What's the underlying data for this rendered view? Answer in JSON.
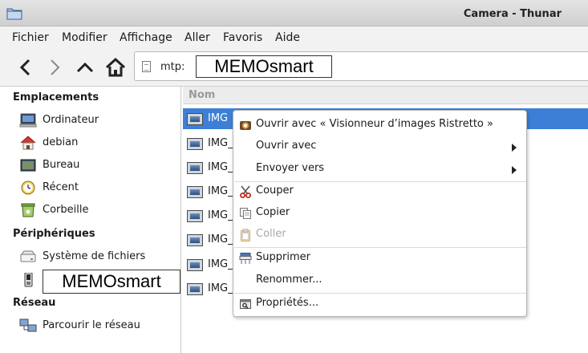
{
  "window": {
    "title": "Camera - Thunar"
  },
  "menubar": {
    "items": [
      "Fichier",
      "Modifier",
      "Affichage",
      "Aller",
      "Favoris",
      "Aide"
    ]
  },
  "toolbar": {
    "back_icon": "chevron-left-icon",
    "forward_icon": "chevron-right-icon",
    "up_icon": "chevron-up-icon",
    "home_icon": "home-icon",
    "location_scheme": "mtp:",
    "location_device": "MEMOsmart"
  },
  "sidebar": {
    "sections": [
      {
        "title": "Emplacements"
      },
      {
        "title": "Périphériques"
      },
      {
        "title": "Réseau"
      }
    ],
    "places": [
      {
        "label": "Ordinateur",
        "icon": "computer-icon"
      },
      {
        "label": "debian",
        "icon": "home-icon"
      },
      {
        "label": "Bureau",
        "icon": "desktop-icon"
      },
      {
        "label": "Récent",
        "icon": "clock-icon"
      },
      {
        "label": "Corbeille",
        "icon": "trash-icon"
      }
    ],
    "devices": [
      {
        "label": "Système de fichiers",
        "icon": "drive-icon"
      },
      {
        "label": "MEMOsmart",
        "icon": "phone-icon"
      }
    ],
    "network": [
      {
        "label": "Parcourir le réseau",
        "icon": "network-icon"
      }
    ]
  },
  "filelist": {
    "column_name": "Nom",
    "files": [
      {
        "name": "IMG",
        "selected": true
      },
      {
        "name": "IMG_",
        "selected": false
      },
      {
        "name": "IMG_",
        "selected": false
      },
      {
        "name": "IMG_",
        "selected": false
      },
      {
        "name": "IMG_",
        "selected": false
      },
      {
        "name": "IMG_",
        "selected": false
      },
      {
        "name": "IMG_",
        "selected": false
      },
      {
        "name": "IMG_",
        "selected": false
      }
    ]
  },
  "context_menu": {
    "items": [
      {
        "label": "Ouvrir avec « Visionneur d’images Ristretto »",
        "icon": "ristretto-icon",
        "enabled": true
      },
      {
        "label": "Ouvrir avec",
        "submenu": true,
        "enabled": true
      },
      {
        "label": "Envoyer vers",
        "submenu": true,
        "enabled": true
      },
      {
        "label": "Couper",
        "icon": "scissors-icon",
        "enabled": true
      },
      {
        "label": "Copier",
        "icon": "copy-icon",
        "enabled": true
      },
      {
        "label": "Coller",
        "icon": "paste-icon",
        "enabled": false
      },
      {
        "label": "Supprimer",
        "icon": "delete-icon",
        "enabled": true
      },
      {
        "label": "Renommer...",
        "enabled": true
      },
      {
        "label": "Propriétés...",
        "icon": "properties-icon",
        "enabled": true
      }
    ]
  },
  "colors": {
    "selection": "#3d7fd6",
    "disabled_text": "#a8a8a8"
  }
}
